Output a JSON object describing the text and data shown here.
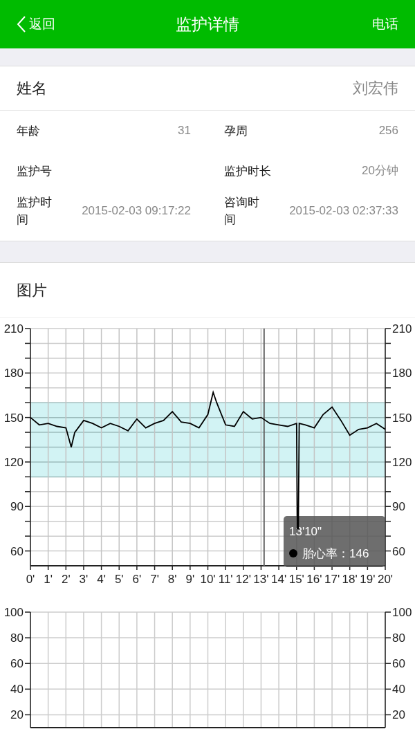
{
  "nav": {
    "back": "返回",
    "title": "监护详情",
    "action": "电话"
  },
  "info": {
    "name_label": "姓名",
    "name_value": "刘宏伟",
    "fields": [
      {
        "label": "年龄",
        "value": "31"
      },
      {
        "label": "孕周",
        "value": "256"
      },
      {
        "label": "监护号"
      },
      {
        "label": "监护时长",
        "value": "20分钟"
      },
      {
        "label": "监护时间",
        "value": "2015-02-03 09:17:22"
      },
      {
        "label": "咨询时间",
        "value": "2015-02-03 02:37:33"
      }
    ]
  },
  "section_title": "图片",
  "charts": [
    {
      "chart_data": {
        "type": "line",
        "xlim": [
          0,
          20
        ],
        "ylim": [
          50,
          210
        ],
        "xticks": [
          {
            "value": 0,
            "label": "0'"
          },
          {
            "value": 1,
            "label": "1'"
          },
          {
            "value": 2,
            "label": "2'"
          },
          {
            "value": 3,
            "label": "3'"
          },
          {
            "value": 4,
            "label": "4'"
          },
          {
            "value": 5,
            "label": "5'"
          },
          {
            "value": 6,
            "label": "6'"
          },
          {
            "value": 7,
            "label": "7'"
          },
          {
            "value": 8,
            "label": "8'"
          },
          {
            "value": 9,
            "label": "9'"
          },
          {
            "value": 10,
            "label": "10'"
          },
          {
            "value": 11,
            "label": "11'"
          },
          {
            "value": 12,
            "label": "12'"
          },
          {
            "value": 13,
            "label": "13'"
          },
          {
            "value": 14,
            "label": "14'"
          },
          {
            "value": 15,
            "label": "15'"
          },
          {
            "value": 16,
            "label": "16'"
          },
          {
            "value": 17,
            "label": "17'"
          },
          {
            "value": 18,
            "label": "18'"
          },
          {
            "value": 19,
            "label": "19'"
          },
          {
            "value": 20,
            "label": "20'"
          }
        ],
        "yticks": [
          60,
          90,
          120,
          150,
          180,
          210
        ],
        "y2lim": [
          50,
          210
        ],
        "y2ticks": [
          60,
          90,
          120,
          150,
          180,
          210
        ],
        "grid": true,
        "x": [
          0,
          0.5,
          1,
          1.5,
          2,
          2.3,
          2.5,
          3,
          3.5,
          4,
          4.5,
          5,
          5.5,
          6,
          6.5,
          7,
          7.5,
          8,
          8.5,
          9,
          9.5,
          10,
          10.3,
          10.5,
          11,
          11.5,
          12,
          12.5,
          13,
          13.5,
          14,
          14.5,
          15,
          15.05,
          15.1,
          15.15,
          15.5,
          16,
          16.5,
          17,
          17.5,
          18,
          18.5,
          19,
          19.5,
          20
        ],
        "series": [
          {
            "name": "胎心率",
            "color": "#000000",
            "values": [
              150,
              145,
              146,
              144,
              143,
              130,
              140,
              148,
              146,
              143,
              146,
              144,
              141,
              149,
              143,
              146,
              148,
              154,
              147,
              146,
              143,
              152,
              167,
              160,
              145,
              144,
              154,
              149,
              150,
              146,
              145,
              144,
              146,
              75,
              75,
              146,
              145,
              143,
              152,
              157,
              148,
              138,
              142,
              143,
              146,
              142
            ]
          }
        ],
        "bands": [
          {
            "axis": "y",
            "from": 110,
            "to": 160,
            "color": "#d2f3f4"
          }
        ],
        "ref_lines": [
          {
            "axis": "x",
            "value": 13.17,
            "color": "#666666"
          }
        ],
        "annotations": [
          {
            "text": "13'10\""
          },
          {
            "text": "：146"
          }
        ]
      }
    },
    {
      "chart_data": {
        "type": "line",
        "xlim": [
          0,
          20
        ],
        "ylim": [
          10,
          100
        ],
        "yticks": [
          20,
          40,
          60,
          80,
          100
        ],
        "y2lim": [
          10,
          100
        ],
        "y2ticks": [
          20,
          40,
          60,
          80,
          100
        ],
        "grid": true
      }
    }
  ]
}
